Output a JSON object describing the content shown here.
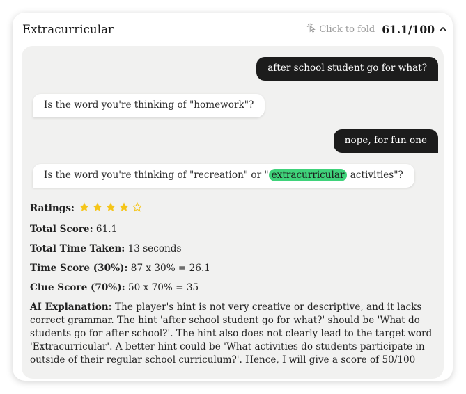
{
  "header": {
    "title": "Extracurricular",
    "fold_label": "Click to fold",
    "score": "61.1/100"
  },
  "chat": [
    {
      "role": "user",
      "text": "after school student go for what?"
    },
    {
      "role": "ai",
      "text": "Is the word you're thinking of \"homework\"?"
    },
    {
      "role": "user",
      "text": "nope, for fun one"
    },
    {
      "role": "ai",
      "text_before": "Is the word you're thinking of \"recreation\" or \"",
      "highlight": "extracurricular",
      "text_after": " activities\"?"
    }
  ],
  "ratings": {
    "label": "Ratings:",
    "value": 4,
    "max": 5,
    "star_color": "#f5c518"
  },
  "stats": {
    "total_score_label": "Total Score:",
    "total_score_value": " 61.1",
    "time_taken_label": "Total Time Taken:",
    "time_taken_value": " 13 seconds",
    "time_score_label": "Time Score (30%):",
    "time_score_value": " 87 x 30% = 26.1",
    "clue_score_label": "Clue Score (70%):",
    "clue_score_value": " 50 x 70% = 35",
    "explanation_label": "AI Explanation:",
    "explanation_value": " The player's hint is not very creative or descriptive, and it lacks correct grammar. The hint 'after school student go for what?' should be 'What do students go for after school?'. The hint also does not clearly lead to the target word 'Extracurricular'. A better hint could be 'What activities do students participate in outside of their regular school curriculum?'. Hence, I will give a score of 50/100"
  },
  "colors": {
    "highlight": "#3fd27a",
    "user_bubble": "#1c1c1c",
    "panel": "#f1f1f0"
  }
}
